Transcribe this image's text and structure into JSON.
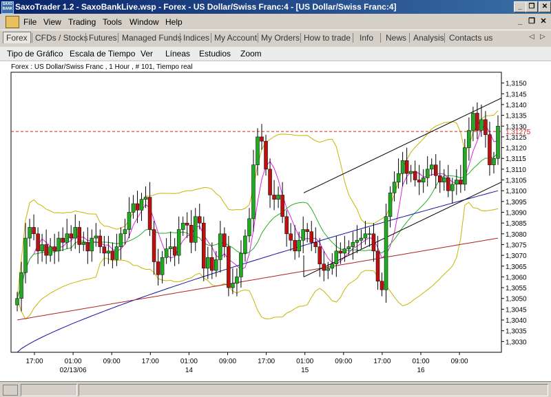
{
  "window": {
    "title": "SaxoTrader 1.2 - SaxoBankLive.wsp - Forex - US Dollar/Swiss Franc:4 - [US Dollar/Swiss Franc:4]",
    "app_icon_text": "SAXO BANK",
    "minimize_glyph": "_",
    "maximize_glyph": "❐",
    "close_glyph": "✕"
  },
  "menu": {
    "items": [
      "File",
      "View",
      "Trading",
      "Tools",
      "Window",
      "Help"
    ],
    "mdi_min": "_",
    "mdi_restore": "❐",
    "mdi_close": "✕"
  },
  "tabs": {
    "items": [
      "Forex",
      "CFDs / Stocks",
      "Futures",
      "Managed Funds",
      "Indices",
      "My Account",
      "My Orders",
      "How to trade",
      "Info",
      "News",
      "Analysis",
      "Contacts us"
    ],
    "active": "Forex",
    "prev_arrow": "◁",
    "next_arrow": "▷"
  },
  "chart_menu": {
    "items": [
      "Tipo de Gráfico",
      "Escala de Tiempo",
      "Ver",
      "Líneas",
      "Estudios",
      "Zoom"
    ]
  },
  "chart_header": "Forex : US Dollar/Swiss Franc , 1 Hour , # 101, Tiempo real",
  "colors": {
    "bull": "#22aa22",
    "bear": "#bb1111",
    "bollinger": "#c8b400",
    "ma_fast": "#e020e0",
    "ma_mid": "#20b020",
    "ma_slow": "#1010a0",
    "ma_long": "#b02020",
    "level_line": "#d02020"
  },
  "chart_data": {
    "type": "candlestick",
    "ylim": [
      1.3025,
      1.3155
    ],
    "yticks": [
      "1,3030",
      "1,3035",
      "1,3040",
      "1,3045",
      "1,3050",
      "1,3055",
      "1,3060",
      "1,3065",
      "1,3070",
      "1,3075",
      "1,3080",
      "1,3085",
      "1,3090",
      "1,3095",
      "1,3100",
      "1,3105",
      "1,3110",
      "1,3115",
      "1,3120",
      "1,3125",
      "1,3130",
      "1,3135",
      "1,3140",
      "1,3145",
      "1,3150"
    ],
    "xticks": [
      {
        "time": "17:00",
        "date": ""
      },
      {
        "time": "01:00",
        "date": "02/13/06"
      },
      {
        "time": "09:00",
        "date": ""
      },
      {
        "time": "17:00",
        "date": ""
      },
      {
        "time": "01:00",
        "date": "14"
      },
      {
        "time": "09:00",
        "date": ""
      },
      {
        "time": "17:00",
        "date": ""
      },
      {
        "time": "01:00",
        "date": "15"
      },
      {
        "time": "09:00",
        "date": ""
      },
      {
        "time": "17:00",
        "date": ""
      },
      {
        "time": "01:00",
        "date": "16"
      },
      {
        "time": "09:00",
        "date": ""
      }
    ],
    "level_label": "1,31275",
    "level_value": 1.31275,
    "closes": [
      1.305,
      1.3062,
      1.3078,
      1.3083,
      1.308,
      1.3072,
      1.3075,
      1.307,
      1.3074,
      1.3072,
      1.3078,
      1.3076,
      1.308,
      1.3078,
      1.3083,
      1.3075,
      1.3076,
      1.3072,
      1.3078,
      1.3079,
      1.3074,
      1.3071,
      1.3072,
      1.3068,
      1.3074,
      1.308,
      1.3082,
      1.309,
      1.3094,
      1.3091,
      1.3096,
      1.3097,
      1.3082,
      1.3067,
      1.3061,
      1.3069,
      1.3073,
      1.3074,
      1.307,
      1.3082,
      1.3085,
      1.3084,
      1.3076,
      1.3088,
      1.3085,
      1.3064,
      1.3069,
      1.3063,
      1.3068,
      1.308,
      1.3074,
      1.3055,
      1.3057,
      1.306,
      1.3071,
      1.3079,
      1.3087,
      1.3112,
      1.3125,
      1.3123,
      1.311,
      1.3098,
      1.3096,
      1.3098,
      1.3088,
      1.308,
      1.3077,
      1.3072,
      1.3077,
      1.3082,
      1.3081,
      1.3076,
      1.3074,
      1.3066,
      1.3063,
      1.3064,
      1.3066,
      1.3072,
      1.3071,
      1.3073,
      1.3074,
      1.3076,
      1.3077,
      1.3078,
      1.308,
      1.308,
      1.3072,
      1.3058,
      1.3054,
      1.3088,
      1.3099,
      1.3104,
      1.3108,
      1.3114,
      1.3108,
      1.3109,
      1.3105,
      1.3104,
      1.3106,
      1.311,
      1.3112,
      1.3107,
      1.3104,
      1.3106,
      1.31,
      1.3103,
      1.3105,
      1.3103,
      1.312,
      1.3128,
      1.3136,
      1.3128,
      1.3133,
      1.3126,
      1.3112,
      1.3115,
      1.313
    ]
  }
}
